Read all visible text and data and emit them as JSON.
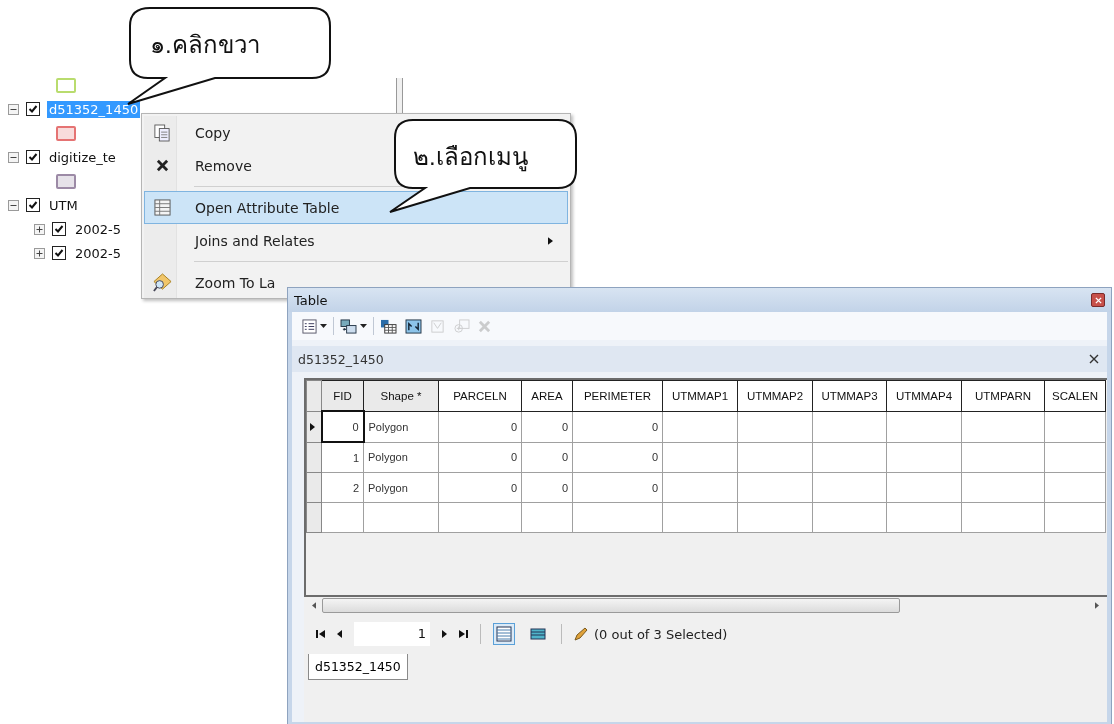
{
  "callouts": [
    {
      "text": "๑.คลิกขวา"
    },
    {
      "text": "๒.เลือกเมนู"
    }
  ],
  "toc": {
    "items": [
      {
        "kind": "legend",
        "color": "#b9dc6e"
      },
      {
        "kind": "layer",
        "name": "d51352_1450",
        "checked": true,
        "expanded": true,
        "selected": true
      },
      {
        "kind": "legend",
        "color": "#e57373"
      },
      {
        "kind": "layer",
        "name": "digitize_te",
        "checked": true,
        "expanded": true,
        "selected": false
      },
      {
        "kind": "legend",
        "color": "#9c8aa6"
      },
      {
        "kind": "layer",
        "name": "UTM",
        "checked": true,
        "expanded": true,
        "selected": false,
        "children": [
          {
            "kind": "layer",
            "name": "2002-5",
            "checked": true,
            "expanded": false,
            "selected": false
          },
          {
            "kind": "layer",
            "name": "2002-5",
            "checked": true,
            "expanded": false,
            "selected": false
          }
        ]
      }
    ]
  },
  "context_menu": {
    "items": [
      {
        "kind": "copy",
        "label": "Copy",
        "selected": false
      },
      {
        "kind": "remove",
        "label": "Remove",
        "selected": false
      },
      {
        "kind": "separator"
      },
      {
        "kind": "table",
        "label": "Open Attribute Table",
        "selected": true
      },
      {
        "kind": "submenu",
        "label": "Joins and Relates",
        "selected": false
      },
      {
        "kind": "separator"
      },
      {
        "kind": "zoom",
        "label": "Zoom To La",
        "selected": false
      }
    ]
  },
  "table_window": {
    "title": "Table",
    "toolbar": [
      {
        "kind": "options",
        "disabled": false
      },
      {
        "kind": "related",
        "disabled": false
      },
      {
        "kind": "select",
        "disabled": false
      },
      {
        "kind": "switch",
        "disabled": false
      },
      {
        "kind": "clear",
        "disabled": true
      },
      {
        "kind": "zoom",
        "disabled": true
      },
      {
        "kind": "delete",
        "disabled": true
      }
    ],
    "tab_title": "d51352_1450",
    "table": {
      "columns": [
        "FID",
        "Shape *",
        "PARCELN",
        "AREA",
        "PERIMETER",
        "UTMMAP1",
        "UTMMAP2",
        "UTMMAP3",
        "UTMMAP4",
        "UTMPARN",
        "SCALEN"
      ],
      "rows": [
        {
          "current": true,
          "cells": [
            "0",
            "Polygon",
            "0",
            "0",
            "0",
            "",
            "",
            "",
            "",
            "",
            ""
          ]
        },
        {
          "current": false,
          "cells": [
            "1",
            "Polygon",
            "0",
            "0",
            "0",
            "",
            "",
            "",
            "",
            "",
            ""
          ]
        },
        {
          "current": false,
          "cells": [
            "2",
            "Polygon",
            "0",
            "0",
            "0",
            "",
            "",
            "",
            "",
            "",
            ""
          ]
        }
      ]
    },
    "record": "1",
    "view_buttons": [
      {
        "kind": "all",
        "selected": true
      },
      {
        "kind": "selected",
        "selected": false
      }
    ],
    "status": "(0 out of 3 Selected)",
    "bottom_tab": "d51352_1450"
  }
}
